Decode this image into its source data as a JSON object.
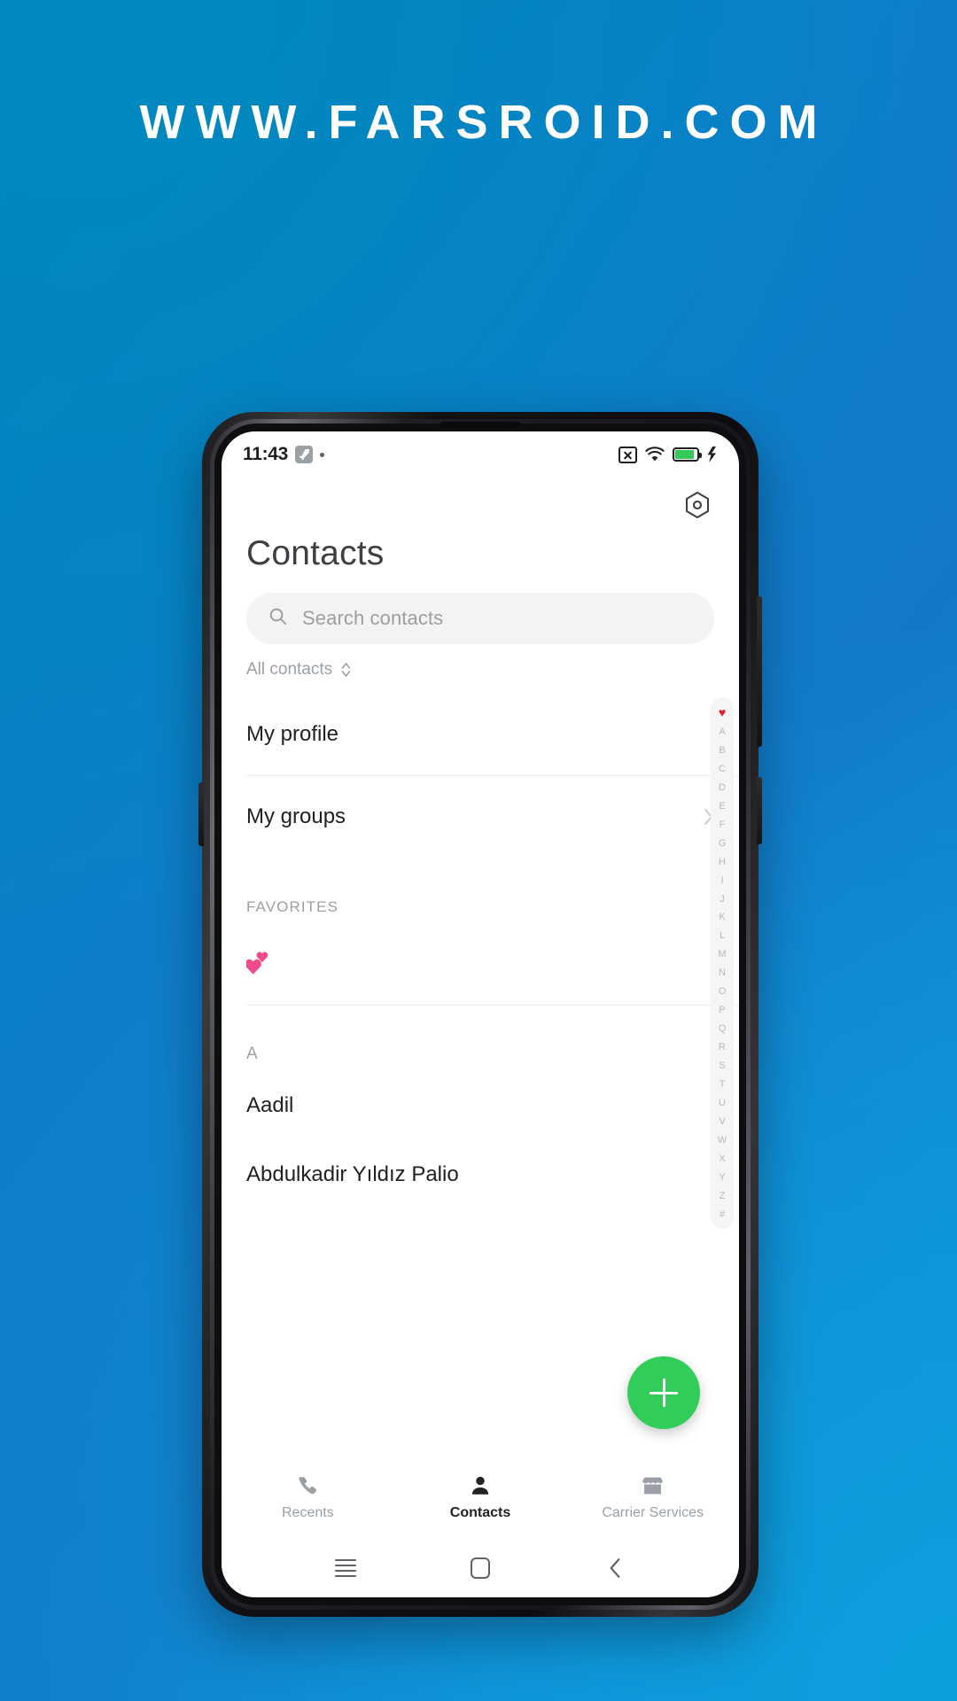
{
  "watermark": {
    "text": "WWW.FARSROID.COM"
  },
  "statusbar": {
    "time": "11:43",
    "icons": [
      "vpn-key-icon",
      "notification-dot",
      "no-sim-icon",
      "wifi-icon",
      "battery-icon",
      "charging-bolt-icon"
    ]
  },
  "header": {
    "title": "Contacts",
    "settings_icon": "hexagon-settings-icon"
  },
  "search": {
    "placeholder": "Search contacts",
    "icon": "search-icon"
  },
  "filter": {
    "label": "All contacts",
    "icon": "expand-vertical-icon"
  },
  "list": {
    "my_profile": "My profile",
    "my_groups": "My groups",
    "favorites_header": "FAVORITES",
    "favorite_entry": "💕",
    "section_a": "A",
    "contacts": [
      "Aadil",
      "Abdulkadir Yıldız Palio"
    ]
  },
  "index_rail": {
    "items": [
      "♥",
      "A",
      "B",
      "C",
      "D",
      "E",
      "F",
      "G",
      "H",
      "I",
      "J",
      "K",
      "L",
      "M",
      "N",
      "O",
      "P",
      "Q",
      "R",
      "S",
      "T",
      "U",
      "V",
      "W",
      "X",
      "Y",
      "Z",
      "#"
    ]
  },
  "fab": {
    "label": "Add contact",
    "icon": "plus-icon",
    "color": "#32cd58"
  },
  "tabbar": {
    "tabs": [
      {
        "label": "Recents",
        "icon": "phone-icon",
        "active": false
      },
      {
        "label": "Contacts",
        "icon": "person-icon",
        "active": true
      },
      {
        "label": "Carrier Services",
        "icon": "store-icon",
        "active": false
      }
    ]
  },
  "navbar": {
    "buttons": [
      "recents-icon",
      "home-icon",
      "back-icon"
    ]
  },
  "colors": {
    "background_start": "#0082bd",
    "background_end": "#0f99dd",
    "accent_green": "#32cd58",
    "heart_red": "#e8192c",
    "favorite_pink": "#ef4a89"
  }
}
